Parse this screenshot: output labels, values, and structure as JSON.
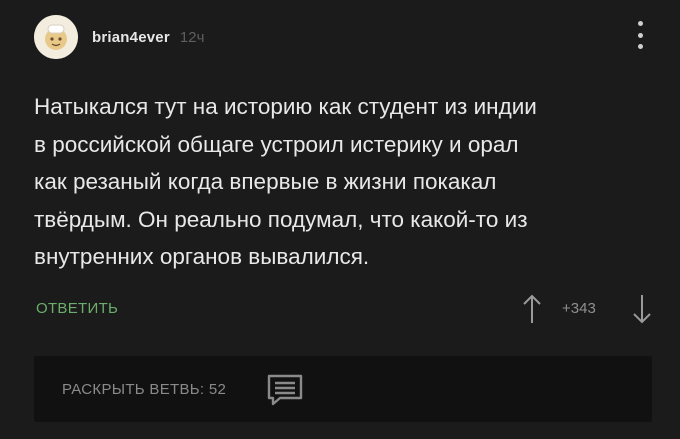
{
  "comment": {
    "author": "brian4ever",
    "time": "12ч",
    "text": "Натыкался тут на историю как студент из индии\nв российской общаге устроил истерику и орал\nкак резаный когда впервые в жизни покакал\nтвёрдым. Он реально подумал, что какой-то из\nвнутренних органов вывалился.",
    "reply_label": "ОТВЕТИТЬ",
    "score": "+343",
    "expand_label": "РАСКРЫТЬ ВЕТВЬ: 52"
  },
  "icons": {
    "avatar": "user-avatar",
    "menu": "more-vertical-icon",
    "vote_up": "arrow-up-icon",
    "vote_down": "arrow-down-icon",
    "branch": "comment-thread-icon"
  },
  "colors": {
    "background": "#1b1b1b",
    "reply": "#6bae6b",
    "text": "#e8e8e8",
    "muted": "#8a8a8a"
  }
}
